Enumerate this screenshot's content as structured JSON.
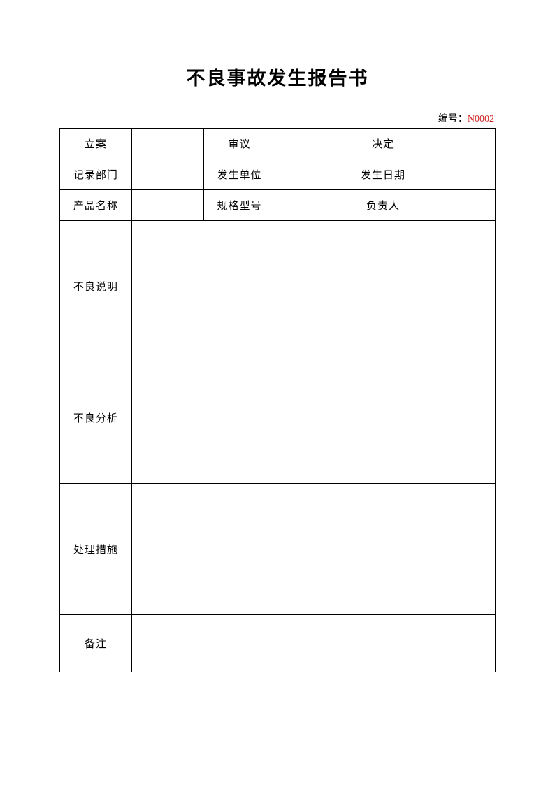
{
  "title": "不良事故发生报告书",
  "serial": {
    "label": "编号：",
    "number": "N0002"
  },
  "headers": {
    "row1": {
      "filing": "立案",
      "review": "审议",
      "decision": "决定"
    },
    "row2": {
      "record_dept": "记录部门",
      "occur_unit": "发生单位",
      "occur_date": "发生日期"
    },
    "row3": {
      "product_name": "产品名称",
      "spec_model": "规格型号",
      "responsible": "负责人"
    },
    "sections": {
      "defect_desc": "不良说明",
      "defect_analysis": "不良分析",
      "measures": "处理措施",
      "remarks": "备注"
    }
  },
  "values": {
    "row1": {
      "filing": "",
      "review": "",
      "decision": ""
    },
    "row2": {
      "record_dept": "",
      "occur_unit": "",
      "occur_date": ""
    },
    "row3": {
      "product_name": "",
      "spec_model": "",
      "responsible": ""
    },
    "defect_desc": "",
    "defect_analysis": "",
    "measures": "",
    "remarks": ""
  }
}
